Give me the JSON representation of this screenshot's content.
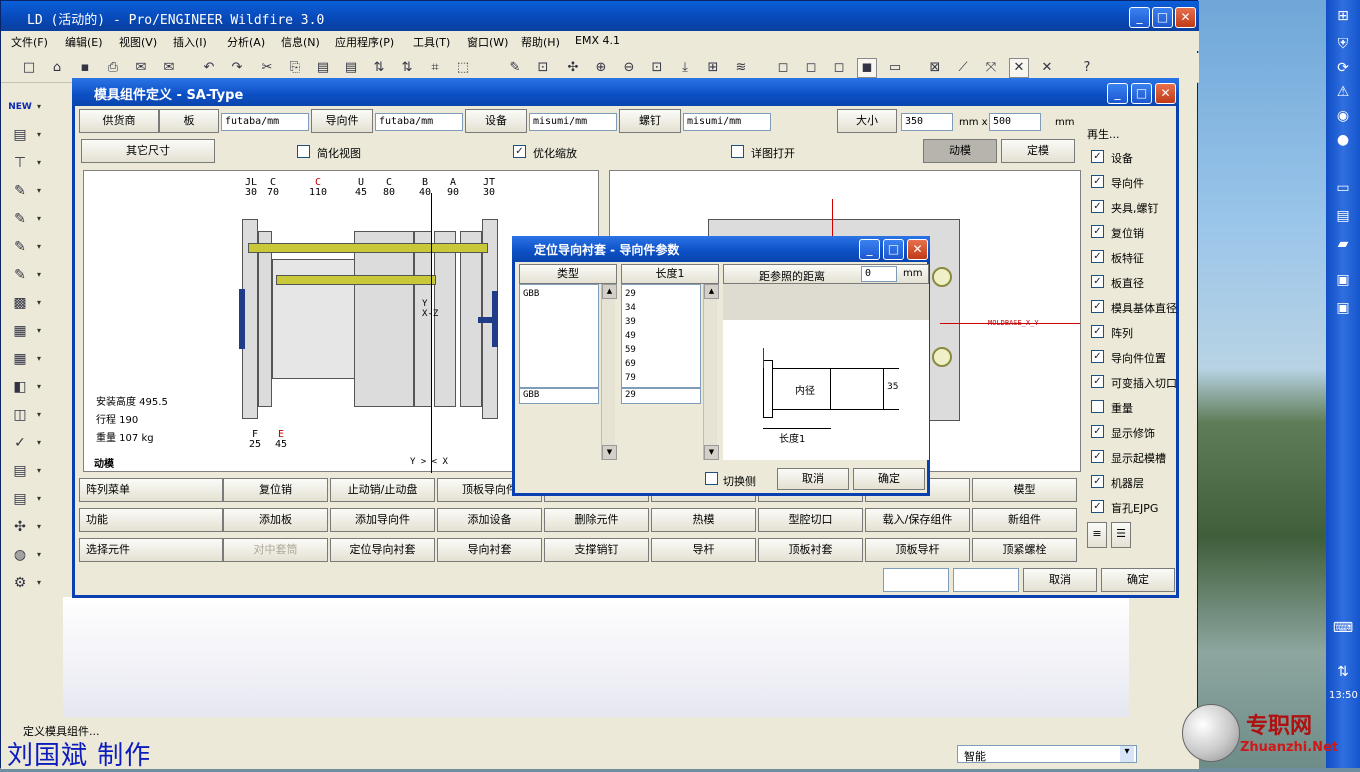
{
  "app": {
    "title": "LD (活动的) - Pro/ENGINEER Wildfire 3.0",
    "menus": [
      "文件(F)",
      "编辑(E)",
      "视图(V)",
      "插入(I)",
      "分析(A)",
      "信息(N)",
      "应用程序(P)",
      "工具(T)",
      "窗口(W)",
      "帮助(H)",
      "EMX 4.1"
    ],
    "status_message": "定义模具组件...",
    "filter_value": "智能",
    "caption": "刘国斌 制作",
    "watermark": {
      "brand": "专职网",
      "url": "Zhuanzhi.Net"
    },
    "clock": "13:50"
  },
  "mold_window": {
    "title": "模具组件定义 - SA-Type",
    "row1": {
      "supplier_label": "供货商",
      "plate_label": "板",
      "plate_value": "futaba/mm",
      "guide_label": "导向件",
      "guide_value": "futaba/mm",
      "equipment_label": "设备",
      "equipment_value": "misumi/mm",
      "screw_label": "螺钉",
      "screw_value": "misumi/mm",
      "size_label": "大小",
      "size_w": "350",
      "size_x_label": "mm x",
      "size_h": "500",
      "size_unit": "mm"
    },
    "row2": {
      "other_dims": "其它尺寸",
      "simplified_view": "简化视图",
      "optimize_zoom": "优化缩放",
      "detail_open": "详图打开",
      "moving_half": "动模",
      "fixed_half": "定模"
    },
    "drawing": {
      "top_labels": [
        {
          "name": "JL",
          "value": "30",
          "red": false
        },
        {
          "name": "C",
          "value": "70",
          "red": false
        },
        {
          "name": "C",
          "value": "110",
          "red": true
        },
        {
          "name": "U",
          "value": "45",
          "red": false
        },
        {
          "name": "C",
          "value": "80",
          "red": false
        },
        {
          "name": "B",
          "value": "40",
          "red": false
        },
        {
          "name": "A",
          "value": "90",
          "red": false
        },
        {
          "name": "JT",
          "value": "30",
          "red": false
        }
      ],
      "bottom_labels": [
        {
          "name": "F",
          "value": "25",
          "red": false
        },
        {
          "name": "E",
          "value": "45",
          "red": true
        }
      ],
      "install_height": "安装高度 495.5",
      "stroke": "行程 190",
      "weight": "重量 107 kg",
      "half_label": "动模",
      "axis_label": "Y > < X",
      "yz_label": "Y\nX-Z",
      "datum_label": "MOLDBASE_X_Y"
    },
    "regenerate": {
      "title": "再生...",
      "items": [
        {
          "label": "设备",
          "checked": true
        },
        {
          "label": "导向件",
          "checked": true
        },
        {
          "label": "夹具,螺钉",
          "checked": true
        },
        {
          "label": "复位销",
          "checked": true
        },
        {
          "label": "板特征",
          "checked": true
        },
        {
          "label": "板直径",
          "checked": true
        },
        {
          "label": "模具基体直径",
          "checked": true
        },
        {
          "label": "阵列",
          "checked": true
        },
        {
          "label": "导向件位置",
          "checked": true
        },
        {
          "label": "可变插入切口",
          "checked": true
        },
        {
          "label": "重量",
          "checked": false
        },
        {
          "label": "显示修饰",
          "checked": true
        },
        {
          "label": "显示起模槽",
          "checked": true
        },
        {
          "label": "机器层",
          "checked": true
        },
        {
          "label": "盲孔EJPG",
          "checked": true
        }
      ]
    },
    "rows": [
      {
        "label": "阵列菜单",
        "buttons": [
          "复位销",
          "止动销/止动盘",
          "顶板导向件",
          "",
          "",
          "",
          "",
          "模型"
        ]
      },
      {
        "label": "功能",
        "buttons": [
          "添加板",
          "添加导向件",
          "添加设备",
          "删除元件",
          "热模",
          "型腔切口",
          "载入/保存组件",
          "新组件"
        ]
      },
      {
        "label": "选择元件",
        "buttons": [
          "对中套筒",
          "定位导向衬套",
          "导向衬套",
          "支撑销钉",
          "导杆",
          "顶板衬套",
          "顶板导杆",
          "顶紧螺栓"
        ]
      }
    ],
    "cancel": "取消",
    "ok": "确定"
  },
  "guide_dialog": {
    "title": "定位导向衬套 - 导向件参数",
    "type_header": "类型",
    "type_items": [
      "GBB"
    ],
    "type_selected": "GBB",
    "length_header": "长度1",
    "length_items": [
      "29",
      "34",
      "39",
      "49",
      "59",
      "69",
      "79"
    ],
    "length_selected": "29",
    "ref_label": "距参照的距离",
    "ref_value": "0",
    "ref_unit": "mm",
    "sketch": {
      "inner_dia": "内径",
      "length": "长度1",
      "dim35": "35"
    },
    "switch_side": "切换侧",
    "cancel": "取消",
    "ok": "确定"
  }
}
